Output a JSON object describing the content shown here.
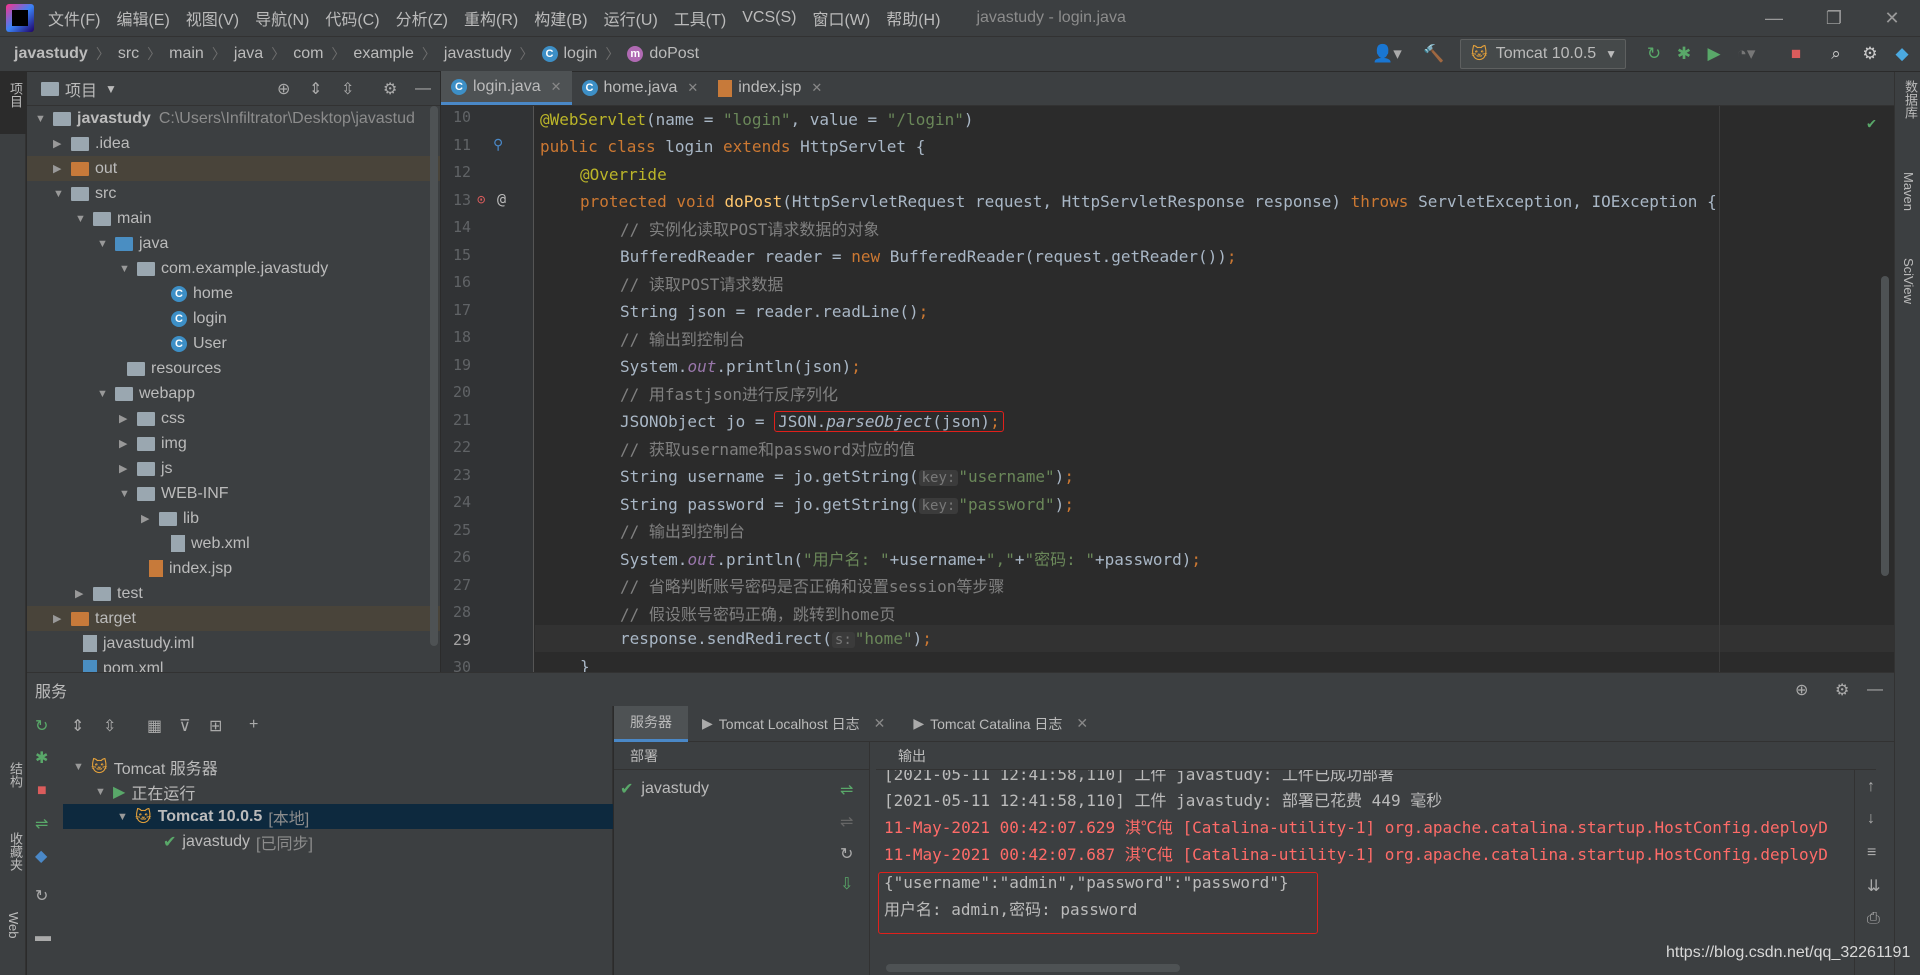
{
  "menu": {
    "items": [
      "文件(F)",
      "编辑(E)",
      "视图(V)",
      "导航(N)",
      "代码(C)",
      "分析(Z)",
      "重构(R)",
      "构建(B)",
      "运行(U)",
      "工具(T)",
      "VCS(S)",
      "窗口(W)",
      "帮助(H)"
    ],
    "window_title": "javastudy - login.java"
  },
  "breadcrumb": [
    "javastudy",
    "src",
    "main",
    "java",
    "com",
    "example",
    "javastudy",
    "login",
    "doPost"
  ],
  "run_config": "Tomcat 10.0.5",
  "project_panel": {
    "title": "项目",
    "root_name": "javastudy",
    "root_path": "C:\\Users\\Infiltrator\\Desktop\\javastud",
    "nodes": [
      ".idea",
      "out",
      "src",
      "main",
      "java",
      "com.example.javastudy",
      "home",
      "login",
      "User",
      "resources",
      "webapp",
      "css",
      "img",
      "js",
      "WEB-INF",
      "lib",
      "web.xml",
      "index.jsp",
      "test",
      "target",
      "javastudy.iml",
      "pom.xml"
    ]
  },
  "editor": {
    "tabs": [
      "login.java",
      "home.java",
      "index.jsp"
    ],
    "line_numbers": [
      "10",
      "11",
      "12",
      "13",
      "14",
      "15",
      "16",
      "17",
      "18",
      "19",
      "20",
      "21",
      "22",
      "23",
      "24",
      "25",
      "26",
      "27",
      "28",
      "29",
      "30"
    ],
    "lines": {
      "l10a": "@WebServlet",
      "l10b": "(name = ",
      "l10c": "\"login\"",
      "l10d": ", value = ",
      "l10e": "\"/login\"",
      "l10f": ")",
      "l11a": "public class ",
      "l11b": "login ",
      "l11c": "extends ",
      "l11d": "HttpServlet {",
      "l12": "@Override",
      "l13a": "protected void ",
      "l13b": "doPost",
      "l13c": "(HttpServletRequest request, HttpServletResponse response) ",
      "l13d": "throws ",
      "l13e": "ServletException, IOException {",
      "l14": "// 实例化读取POST请求数据的对象",
      "l15a": "BufferedReader reader = ",
      "l15b": "new ",
      "l15c": "BufferedReader(request.getReader())",
      "l15d": ";",
      "l16": "// 读取POST请求数据",
      "l17a": "String json = reader.readLine()",
      "l17b": ";",
      "l18": "// 输出到控制台",
      "l19a": "System.",
      "l19b": "out",
      "l19c": ".println(json)",
      "l19d": ";",
      "l20": "// 用fastjson进行反序列化",
      "l21a": "JSONObject jo = ",
      "l21b": "JSON.",
      "l21c": "parseObject",
      "l21d": "(json)",
      "l21e": ";",
      "l22": "// 获取username和password对应的值",
      "l23a": "String username = jo.getString(",
      "l23h": "key:",
      "l23b": "\"username\"",
      "l23c": ")",
      "l23d": ";",
      "l24a": "String password = jo.getString(",
      "l24h": "key:",
      "l24b": "\"password\"",
      "l24c": ")",
      "l24d": ";",
      "l25": "// 输出到控制台",
      "l26a": "System.",
      "l26b": "out",
      "l26c": ".println(",
      "l26d": "\"用户名: \"",
      "l26e": "+username+",
      "l26f": "\",\"",
      "l26g": "+",
      "l26h": "\"密码: \"",
      "l26i": "+password)",
      "l26j": ";",
      "l27": "// 省略判断账号密码是否正确和设置session等步骤",
      "l28": "// 假设账号密码正确，跳转到home页",
      "l29a": "response.sendRedirect(",
      "l29h": "s:",
      "l29b": "\"home\"",
      "l29c": ")",
      "l29d": ";",
      "l30": "}"
    }
  },
  "services": {
    "title": "服务",
    "tree": {
      "server_group": "Tomcat 服务器",
      "running": "正在运行",
      "server": "Tomcat 10.0.5",
      "server_tag": "[本地]",
      "artifact": "javastudy",
      "artifact_tag": "[已同步]"
    },
    "tabs": [
      "服务器",
      "Tomcat Localhost 日志",
      "Tomcat Catalina 日志"
    ],
    "deploy_header": "部署",
    "deploy_item": "javastudy",
    "output_header": "输出",
    "output_lines": [
      "[2021-05-11 12:41:58,110] 工件 javastudy: 工件已成功部署",
      "[2021-05-11 12:41:58,110] 工件 javastudy: 部署已花费 449 毫秒",
      "11-May-2021 00:42:07.629 淇℃伅 [Catalina-utility-1] org.apache.catalina.startup.HostConfig.deployD",
      "11-May-2021 00:42:07.687 淇℃伅 [Catalina-utility-1] org.apache.catalina.startup.HostConfig.deployD",
      "{\"username\":\"admin\",\"password\":\"password\"}",
      "用户名: admin,密码: password"
    ]
  },
  "left_strip": {
    "project": "项目",
    "structure": "结构",
    "favorites": "收藏夹",
    "web": "Web"
  },
  "right_strip": {
    "database": "数据库",
    "maven": "Maven",
    "sciview": "SciView"
  },
  "watermark": "https://blog.csdn.net/qq_32261191"
}
